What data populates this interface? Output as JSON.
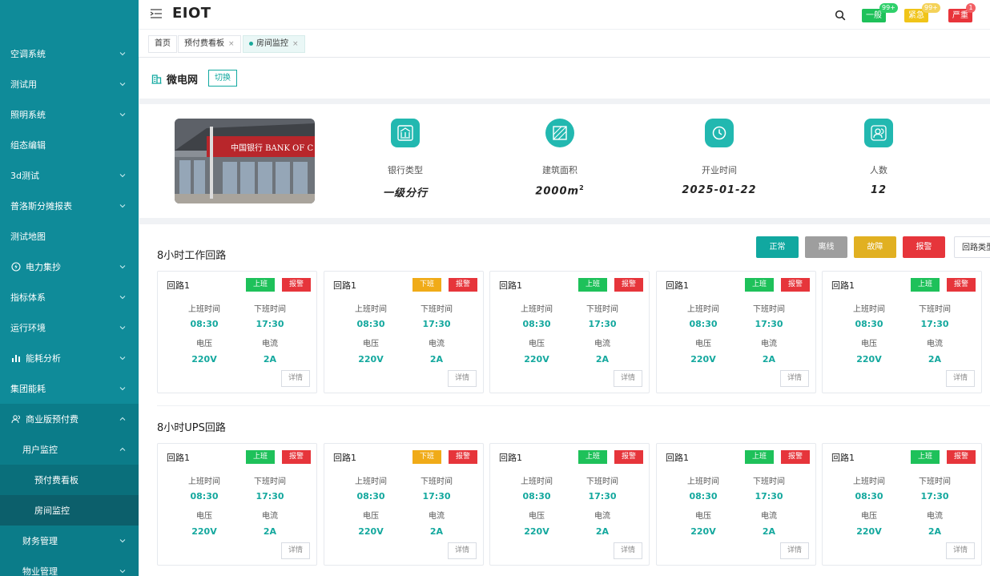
{
  "header": {
    "title": "EIOT"
  },
  "alerts": [
    {
      "label": "一般",
      "count": "99+"
    },
    {
      "label": "紧急",
      "count": "99+"
    },
    {
      "label": "严重",
      "count": "1"
    }
  ],
  "tabs": [
    {
      "label": "首页"
    },
    {
      "label": "预付费看板",
      "close": "×"
    },
    {
      "label": "房间监控",
      "close": "×"
    }
  ],
  "sidebar": {
    "items": [
      {
        "label": "空调系统"
      },
      {
        "label": "测试用"
      },
      {
        "label": "照明系统"
      },
      {
        "label": "组态编辑"
      },
      {
        "label": "3d测试"
      },
      {
        "label": "普洛斯分摊报表"
      },
      {
        "label": "测试地图"
      },
      {
        "label": "电力集抄"
      },
      {
        "label": "指标体系"
      },
      {
        "label": "运行环境"
      },
      {
        "label": "能耗分析"
      },
      {
        "label": "集团能耗"
      },
      {
        "label": "商业版预付费"
      },
      {
        "label": "用户监控"
      },
      {
        "label": "预付费看板"
      },
      {
        "label": "房间监控"
      },
      {
        "label": "财务管理"
      },
      {
        "label": "物业管理"
      }
    ]
  },
  "site": {
    "name": "微电网",
    "switch_label": "切换"
  },
  "stats": [
    {
      "label": "银行类型",
      "value": "一级分行"
    },
    {
      "label": "建筑面积",
      "value": "2000m",
      "unit_sup": "2"
    },
    {
      "label": "开业时间",
      "value": "2025-01-22"
    },
    {
      "label": "人数",
      "value": "12"
    }
  ],
  "photo": {
    "sign_text": "中国银行 BANK OF C"
  },
  "legend": {
    "normal": "正常",
    "offline": "离线",
    "fault": "故障",
    "alarm": "报警",
    "type": "回路类型"
  },
  "sections": [
    {
      "title": "8小时工作回路",
      "cards": [
        {
          "name": "回路1",
          "status": "上班",
          "alarm": "报警",
          "on_label": "上班时间",
          "off_label": "下班时间",
          "on_time": "08:30",
          "off_time": "17:30",
          "v_label": "电压",
          "i_label": "电流",
          "voltage": "220V",
          "current": "2A",
          "detail": "详情"
        },
        {
          "name": "回路1",
          "status": "下班",
          "alarm": "报警",
          "on_label": "上班时间",
          "off_label": "下班时间",
          "on_time": "08:30",
          "off_time": "17:30",
          "v_label": "电压",
          "i_label": "电流",
          "voltage": "220V",
          "current": "2A",
          "detail": "详情"
        },
        {
          "name": "回路1",
          "status": "上班",
          "alarm": "报警",
          "on_label": "上班时间",
          "off_label": "下班时间",
          "on_time": "08:30",
          "off_time": "17:30",
          "v_label": "电压",
          "i_label": "电流",
          "voltage": "220V",
          "current": "2A",
          "detail": "详情"
        },
        {
          "name": "回路1",
          "status": "上班",
          "alarm": "报警",
          "on_label": "上班时间",
          "off_label": "下班时间",
          "on_time": "08:30",
          "off_time": "17:30",
          "v_label": "电压",
          "i_label": "电流",
          "voltage": "220V",
          "current": "2A",
          "detail": "详情"
        },
        {
          "name": "回路1",
          "status": "上班",
          "alarm": "报警",
          "on_label": "上班时间",
          "off_label": "下班时间",
          "on_time": "08:30",
          "off_time": "17:30",
          "v_label": "电压",
          "i_label": "电流",
          "voltage": "220V",
          "current": "2A",
          "detail": "详情"
        }
      ]
    },
    {
      "title": "8小时UPS回路",
      "cards": [
        {
          "name": "回路1",
          "status": "上班",
          "alarm": "报警",
          "on_label": "上班时间",
          "off_label": "下班时间",
          "on_time": "08:30",
          "off_time": "17:30",
          "v_label": "电压",
          "i_label": "电流",
          "voltage": "220V",
          "current": "2A",
          "detail": "详情"
        },
        {
          "name": "回路1",
          "status": "下班",
          "alarm": "报警",
          "on_label": "上班时间",
          "off_label": "下班时间",
          "on_time": "08:30",
          "off_time": "17:30",
          "v_label": "电压",
          "i_label": "电流",
          "voltage": "220V",
          "current": "2A",
          "detail": "详情"
        },
        {
          "name": "回路1",
          "status": "上班",
          "alarm": "报警",
          "on_label": "上班时间",
          "off_label": "下班时间",
          "on_time": "08:30",
          "off_time": "17:30",
          "v_label": "电压",
          "i_label": "电流",
          "voltage": "220V",
          "current": "2A",
          "detail": "详情"
        },
        {
          "name": "回路1",
          "status": "上班",
          "alarm": "报警",
          "on_label": "上班时间",
          "off_label": "下班时间",
          "on_time": "08:30",
          "off_time": "17:30",
          "v_label": "电压",
          "i_label": "电流",
          "voltage": "220V",
          "current": "2A",
          "detail": "详情"
        },
        {
          "name": "回路1",
          "status": "上班",
          "alarm": "报警",
          "on_label": "上班时间",
          "off_label": "下班时间",
          "on_time": "08:30",
          "off_time": "17:30",
          "v_label": "电压",
          "i_label": "电流",
          "voltage": "220V",
          "current": "2A",
          "detail": "详情"
        }
      ]
    }
  ],
  "colors": {
    "sidebar_bg": "#0f8b99",
    "accent": "#12a9a0",
    "status_on": "#1ec15a",
    "status_off": "#f0ab18",
    "alarm": "#e6353b"
  }
}
